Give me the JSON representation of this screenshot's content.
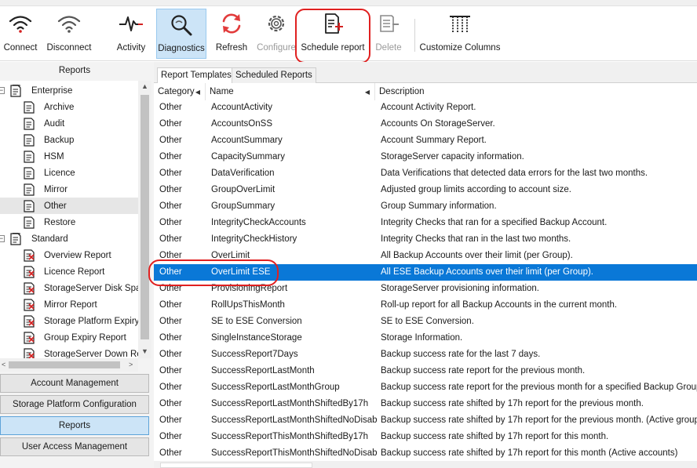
{
  "toolbar": {
    "connect": "Connect",
    "disconnect": "Disconnect",
    "activity": "Activity",
    "diagnostics": "Diagnostics",
    "refresh": "Refresh",
    "configure": "Configure",
    "schedule_report": "Schedule report",
    "delete": "Delete",
    "customize_columns": "Customize Columns"
  },
  "sidebar": {
    "header": "Reports",
    "tree": [
      {
        "label": "Enterprise",
        "level": 0,
        "expander": "−"
      },
      {
        "label": "Archive",
        "level": 1
      },
      {
        "label": "Audit",
        "level": 1
      },
      {
        "label": "Backup",
        "level": 1
      },
      {
        "label": "HSM",
        "level": 1
      },
      {
        "label": "Licence",
        "level": 1
      },
      {
        "label": "Mirror",
        "level": 1
      },
      {
        "label": "Other",
        "level": 1,
        "selected": true
      },
      {
        "label": "Restore",
        "level": 1
      },
      {
        "label": "Standard",
        "level": 0,
        "expander": "−"
      },
      {
        "label": "Overview Report",
        "level": 1,
        "error": true
      },
      {
        "label": "Licence Report",
        "level": 1,
        "error": true
      },
      {
        "label": "StorageServer Disk Spac",
        "level": 1,
        "error": true
      },
      {
        "label": "Mirror Report",
        "level": 1,
        "error": true
      },
      {
        "label": "Storage Platform Expiry",
        "level": 1,
        "error": true
      },
      {
        "label": "Group Expiry Report",
        "level": 1,
        "error": true
      },
      {
        "label": "StorageServer Down Re",
        "level": 1,
        "error": true
      }
    ],
    "nav": {
      "account_management": "Account Management",
      "storage_platform_configuration": "Storage Platform Configuration",
      "reports": "Reports",
      "user_access_management": "User Access Management"
    }
  },
  "tabs": {
    "report_templates": "Report Templates",
    "scheduled_reports": "Scheduled Reports"
  },
  "grid": {
    "headers": {
      "category": "Category",
      "name": "Name",
      "description": "Description"
    },
    "rows": [
      {
        "category": "Other",
        "name": "AccountActivity",
        "description": "Account Activity Report."
      },
      {
        "category": "Other",
        "name": "AccountsOnSS",
        "description": "Accounts On StorageServer."
      },
      {
        "category": "Other",
        "name": "AccountSummary",
        "description": "Account Summary Report."
      },
      {
        "category": "Other",
        "name": "CapacitySummary",
        "description": "StorageServer capacity information."
      },
      {
        "category": "Other",
        "name": "DataVerification",
        "description": "Data Verifications that detected data errors for the last two months."
      },
      {
        "category": "Other",
        "name": "GroupOverLimit",
        "description": "Adjusted group limits according to account size."
      },
      {
        "category": "Other",
        "name": "GroupSummary",
        "description": "Group Summary information."
      },
      {
        "category": "Other",
        "name": "IntegrityCheckAccounts",
        "description": "Integrity Checks that ran for a specified Backup Account."
      },
      {
        "category": "Other",
        "name": "IntegrityCheckHistory",
        "description": "Integrity Checks that ran in the last two months."
      },
      {
        "category": "Other",
        "name": "OverLimit",
        "description": "All Backup Accounts over their limit (per Group)."
      },
      {
        "category": "Other",
        "name": "OverLimit ESE",
        "description": "All ESE Backup Accounts over their limit (per Group).",
        "selected": true
      },
      {
        "category": "Other",
        "name": "ProvisioningReport",
        "description": "StorageServer provisioning information."
      },
      {
        "category": "Other",
        "name": "RollUpsThisMonth",
        "description": "Roll-up report for all Backup Accounts in the current month."
      },
      {
        "category": "Other",
        "name": "SE to ESE Conversion",
        "description": "SE to ESE Conversion."
      },
      {
        "category": "Other",
        "name": "SingleInstanceStorage",
        "description": "Storage Information."
      },
      {
        "category": "Other",
        "name": "SuccessReport7Days",
        "description": "Backup success rate for the last 7 days."
      },
      {
        "category": "Other",
        "name": "SuccessReportLastMonth",
        "description": "Backup success rate report for the previous month."
      },
      {
        "category": "Other",
        "name": "SuccessReportLastMonthGroup",
        "description": "Backup success rate report for the previous month for a specified Backup Group."
      },
      {
        "category": "Other",
        "name": "SuccessReportLastMonthShiftedBy17h",
        "description": "Backup success rate shifted by 17h report for the previous month."
      },
      {
        "category": "Other",
        "name": "SuccessReportLastMonthShiftedNoDisabled",
        "description": "Backup success rate shifted by 17h report for the previous month. (Active groups)"
      },
      {
        "category": "Other",
        "name": "SuccessReportThisMonthShiftedBy17h",
        "description": "Backup success rate shifted by 17h report for this month."
      },
      {
        "category": "Other",
        "name": "SuccessReportThisMonthShiftedNoDisabled",
        "description": "Backup success rate shifted by 17h report for this month (Active accounts)"
      }
    ]
  },
  "colors": {
    "selection": "#0a78d7",
    "active_tool": "#cce4f7",
    "annotation_ring": "#e02020",
    "refresh_red": "#e23b3b"
  }
}
